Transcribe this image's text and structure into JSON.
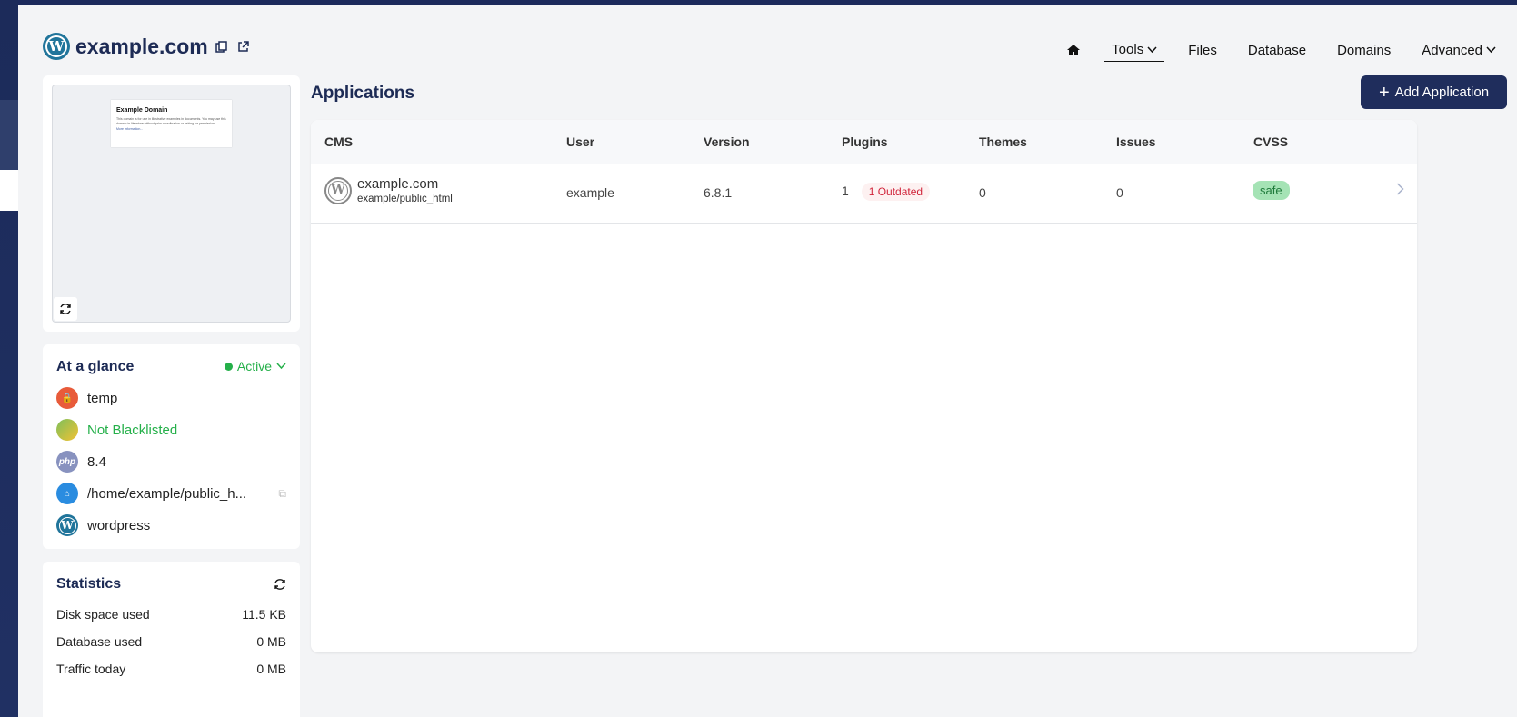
{
  "header": {
    "site_name": "example.com",
    "nav": {
      "tools": "Tools",
      "files": "Files",
      "database": "Database",
      "domains": "Domains",
      "advanced": "Advanced"
    }
  },
  "preview": {
    "mini_title": "Example Domain",
    "mini_text": "This domain is for use in illustrative examples in documents. You may use this domain in literature without prior coordination or asking for permission.",
    "mini_link": "More information..."
  },
  "glance": {
    "title": "At a glance",
    "status": "Active",
    "rows": [
      {
        "icon": "ssl-lock-icon",
        "text": "temp"
      },
      {
        "icon": "globe-icon",
        "text": "Not Blacklisted"
      },
      {
        "icon": "php-icon",
        "text": "8.4"
      },
      {
        "icon": "folder-icon",
        "text": "/home/example/public_h..."
      },
      {
        "icon": "wordpress-icon",
        "text": "wordpress"
      }
    ]
  },
  "statistics": {
    "title": "Statistics",
    "rows": [
      {
        "label": "Disk space used",
        "value": "11.5 KB"
      },
      {
        "label": "Database used",
        "value": "0 MB"
      },
      {
        "label": "Traffic today",
        "value": "0 MB"
      }
    ]
  },
  "applications": {
    "title": "Applications",
    "add_label": "Add Application",
    "columns": [
      "CMS",
      "User",
      "Version",
      "Plugins",
      "Themes",
      "Issues",
      "CVSS"
    ],
    "rows": [
      {
        "cms_name": "example.com",
        "cms_path": "example/public_html",
        "user": "example",
        "version": "6.8.1",
        "plugins": "1",
        "plugins_badge": "1 Outdated",
        "themes": "0",
        "issues": "0",
        "cvss": "safe"
      }
    ]
  },
  "colors": {
    "brand_navy": "#1f2d5c",
    "active_green": "#25b04a",
    "outdated_red": "#d0243a",
    "safe_green": "#a5e3b5"
  }
}
